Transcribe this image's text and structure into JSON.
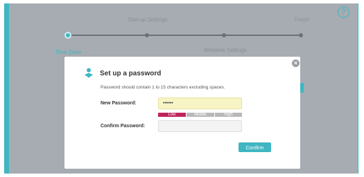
{
  "wizard": {
    "steps_top": [
      "Dial-up Settings",
      "Finish"
    ],
    "steps_bottom": [
      "Time Zone",
      "Wireless Settings"
    ],
    "help_icon": "?"
  },
  "dialog": {
    "title": "Set up a password",
    "hint": "Password should contain 1 to 15 characters excluding spaces.",
    "new_password_label": "New Password:",
    "new_password_value": "••••••",
    "confirm_password_label": "Confirm Password:",
    "confirm_password_value": "",
    "strength_levels": [
      "Low",
      "Middle",
      "High"
    ],
    "strength_active": "Low",
    "confirm_button": "Confirm",
    "close_icon": "×"
  },
  "colors": {
    "accent": "#3fb6c2",
    "strength_low": "#c0245c",
    "strength_inactive": "#b8b8b8",
    "overlay": "#a6acb1"
  }
}
